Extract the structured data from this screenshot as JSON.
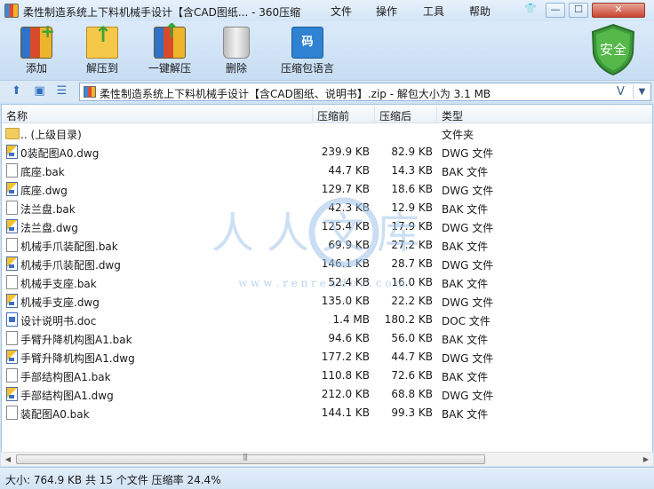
{
  "window": {
    "title": "柔性制造系统上下料机械手设计【含CAD图纸... - 360压缩",
    "menu": [
      "文件",
      "操作",
      "工具",
      "帮助"
    ],
    "controls": {
      "skin": "👕",
      "minimize": "—",
      "maximize": "☐",
      "close": "✕"
    }
  },
  "toolbar": {
    "add": "添加",
    "extract_to": "解压到",
    "one_click_extract": "一键解压",
    "delete": "删除",
    "code_language": "压缩包语言",
    "code_icon_text": "码",
    "security": "安全"
  },
  "address": {
    "path": "柔性制造系统上下料机械手设计【含CAD图纸、说明书】.zip - 解包大小为 3.1 MB",
    "v_icon": "V",
    "dropdown": "▼"
  },
  "columns": {
    "name": "名称",
    "size": "压缩前",
    "compressed": "压缩后",
    "type": "类型"
  },
  "files": [
    {
      "name": ".. (上级目录)",
      "size": "",
      "compressed": "",
      "type": "文件夹",
      "icon": "folder"
    },
    {
      "name": "0装配图A0.dwg",
      "size": "239.9 KB",
      "compressed": "82.9 KB",
      "type": "DWG 文件",
      "icon": "dwg"
    },
    {
      "name": "底座.bak",
      "size": "44.7 KB",
      "compressed": "14.3 KB",
      "type": "BAK 文件",
      "icon": "bak"
    },
    {
      "name": "底座.dwg",
      "size": "129.7 KB",
      "compressed": "18.6 KB",
      "type": "DWG 文件",
      "icon": "dwg"
    },
    {
      "name": "法兰盘.bak",
      "size": "42.3 KB",
      "compressed": "12.9 KB",
      "type": "BAK 文件",
      "icon": "bak"
    },
    {
      "name": "法兰盘.dwg",
      "size": "125.4 KB",
      "compressed": "17.9 KB",
      "type": "DWG 文件",
      "icon": "dwg"
    },
    {
      "name": "机械手爪装配图.bak",
      "size": "69.9 KB",
      "compressed": "27.2 KB",
      "type": "BAK 文件",
      "icon": "bak"
    },
    {
      "name": "机械手爪装配图.dwg",
      "size": "146.1 KB",
      "compressed": "28.7 KB",
      "type": "DWG 文件",
      "icon": "dwg"
    },
    {
      "name": "机械手支座.bak",
      "size": "52.4 KB",
      "compressed": "16.0 KB",
      "type": "BAK 文件",
      "icon": "bak"
    },
    {
      "name": "机械手支座.dwg",
      "size": "135.0 KB",
      "compressed": "22.2 KB",
      "type": "DWG 文件",
      "icon": "dwg"
    },
    {
      "name": "设计说明书.doc",
      "size": "1.4 MB",
      "compressed": "180.2 KB",
      "type": "DOC 文件",
      "icon": "doc"
    },
    {
      "name": "手臂升降机构图A1.bak",
      "size": "94.6 KB",
      "compressed": "56.0 KB",
      "type": "BAK 文件",
      "icon": "bak"
    },
    {
      "name": "手臂升降机构图A1.dwg",
      "size": "177.2 KB",
      "compressed": "44.7 KB",
      "type": "DWG 文件",
      "icon": "dwg"
    },
    {
      "name": "手部结构图A1.bak",
      "size": "110.8 KB",
      "compressed": "72.6 KB",
      "type": "BAK 文件",
      "icon": "bak"
    },
    {
      "name": "手部结构图A1.dwg",
      "size": "212.0 KB",
      "compressed": "68.8 KB",
      "type": "DWG 文件",
      "icon": "dwg"
    },
    {
      "name": "装配图A0.bak",
      "size": "144.1 KB",
      "compressed": "99.3 KB",
      "type": "BAK 文件",
      "icon": "bak"
    }
  ],
  "watermark": {
    "text": "人人文库",
    "url": "w w w . r e n r e n d o c . c o m"
  },
  "status": "大小: 764.9 KB 共 15 个文件 压缩率 24.4%",
  "colors": {
    "accent": "#2f6fbf",
    "shield": "#3a9a3a",
    "watermark": "#9cc3e8"
  }
}
